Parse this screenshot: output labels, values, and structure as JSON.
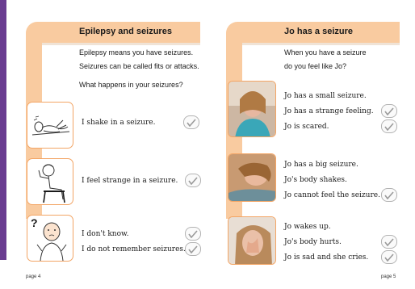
{
  "left_page": {
    "title": "Epilepsy and seizures",
    "intro_line1": "Epilepsy means you have seizures.",
    "intro_line2": "Seizures can be called fits or attacks.",
    "question": "What happens in your seizures?",
    "items": [
      {
        "icon": "person-lying-down-icon",
        "text": "I shake in a seizure."
      },
      {
        "icon": "person-sitting-dizzy-icon",
        "text": "I feel strange in a seizure."
      },
      {
        "icon": "person-question-icon",
        "mark": "?",
        "text1": "I don't know.",
        "text2": "I do not remember seizures."
      }
    ],
    "page_number": "page 4"
  },
  "right_page": {
    "title": "Jo has a seizure",
    "question_line1": "When you have a seizure",
    "question_line2": "do you feel like Jo?",
    "groups": [
      {
        "lines": [
          "Jo has a small seizure.",
          "Jo has a strange feeling.",
          "Jo is scared."
        ]
      },
      {
        "lines": [
          "Jo has a big seizure.",
          "Jo's body shakes.",
          "Jo cannot feel the seizure."
        ]
      },
      {
        "lines": [
          "Jo wakes up.",
          "Jo's body hurts.",
          "Jo is sad and she cries."
        ]
      }
    ],
    "page_number": "page 5"
  },
  "colors": {
    "accent_orange": "#f9cba0",
    "frame_orange": "#f3a565",
    "edge_purple": "#6a3d91"
  }
}
